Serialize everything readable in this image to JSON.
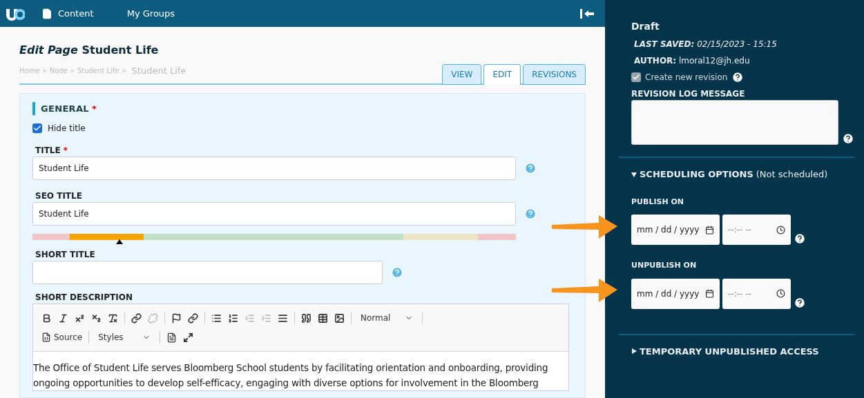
{
  "topbar": {
    "items": [
      {
        "label": "Content",
        "kind": "page"
      },
      {
        "label": "My Groups",
        "kind": "none"
      }
    ]
  },
  "page": {
    "title_prefix": "Edit Page",
    "title": "Student Life",
    "breadcrumbs": [
      "Home",
      "Node",
      "Student Life"
    ],
    "breadcrumb_separator": "»",
    "current": "Student Life"
  },
  "tabs": [
    {
      "label": "VIEW",
      "selected": false
    },
    {
      "label": "EDIT",
      "selected": true
    },
    {
      "label": "REVISIONS",
      "selected": false
    }
  ],
  "general": {
    "heading": "GENERAL",
    "required_mark": "*",
    "hide_title": {
      "label": "Hide title",
      "checked": true
    },
    "title": {
      "label": "TITLE",
      "required_mark": "*",
      "value": "Student Life"
    },
    "seo_title": {
      "label": "SEO TITLE",
      "value": "Student Life",
      "level": 0.18
    },
    "short_title": {
      "label": "SHORT TITLE"
    },
    "short_description": {
      "label": "SHORT DESCRIPTION",
      "toolbar_row1": [
        {
          "kind": "bold",
          "disabled": false
        },
        {
          "kind": "italic",
          "disabled": false
        },
        {
          "kind": "superscript",
          "disabled": false
        },
        {
          "kind": "subscript",
          "disabled": false
        },
        {
          "kind": "clear",
          "disabled": false
        },
        {
          "kind": "sep"
        },
        {
          "kind": "link",
          "disabled": false
        },
        {
          "kind": "unlink",
          "disabled": true
        },
        {
          "kind": "sep"
        },
        {
          "kind": "flag",
          "disabled": false
        },
        {
          "kind": "link",
          "disabled": false
        },
        {
          "kind": "sep"
        },
        {
          "kind": "bullets",
          "disabled": false
        },
        {
          "kind": "numbers",
          "disabled": false
        },
        {
          "kind": "outdent",
          "disabled": true
        },
        {
          "kind": "indent",
          "disabled": true
        },
        {
          "kind": "justify",
          "disabled": false
        },
        {
          "kind": "sep"
        },
        {
          "kind": "quote",
          "disabled": false
        },
        {
          "kind": "table",
          "disabled": false
        },
        {
          "kind": "media",
          "disabled": false
        },
        {
          "kind": "sep"
        }
      ],
      "format_select": "Normal",
      "source_button": "Source",
      "styles_select": "Styles",
      "body": "The Office of Student Life serves Bloomberg School students by facilitating orientation and onboarding, providing ongoing opportunities to develop self-efficacy, engaging with diverse options for involvement in the Bloomberg"
    }
  },
  "sidebar": {
    "status": "Draft",
    "last_saved_label": "LAST SAVED:",
    "last_saved": "02/15/2023 - 15:15",
    "author_label": "AUTHOR:",
    "author": "lmoral12@jh.edu",
    "new_revision": {
      "label": "Create new revision",
      "checked": true,
      "disabled": true
    },
    "log_label": "REVISION LOG MESSAGE",
    "scheduling": {
      "title": "SCHEDULING OPTIONS",
      "note": "(Not scheduled)",
      "expanded": true,
      "fields": [
        {
          "label": "PUBLISH ON",
          "date_placeholder": "mm / dd / yyyy",
          "time_placeholder": "--:-- --"
        },
        {
          "label": "UNPUBLISH ON",
          "date_placeholder": "mm / dd / yyyy",
          "time_placeholder": "--:-- --"
        }
      ]
    },
    "temporary": {
      "title": "TEMPORARY UNPUBLISHED ACCESS",
      "expanded": false
    }
  }
}
